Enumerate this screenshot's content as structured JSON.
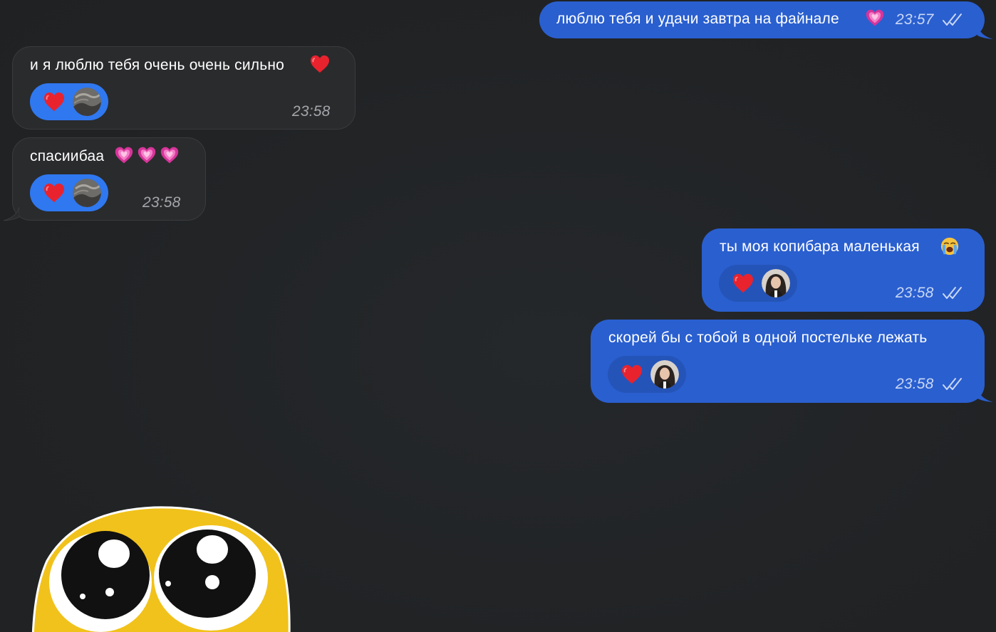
{
  "messages": [
    {
      "id": "m1",
      "direction": "outgoing",
      "text": "люблю тебя и удачи завтра на файнале",
      "emoji": "pink-heart",
      "time": "23:57",
      "status": "read"
    },
    {
      "id": "m2",
      "direction": "incoming",
      "text": "и я люблю тебя очень очень сильно",
      "emoji": "red-heart",
      "time": "23:58",
      "reaction": {
        "emoji": "red-heart",
        "reactor": "contact-avatar"
      }
    },
    {
      "id": "m3",
      "direction": "incoming",
      "text": "спасиибаа",
      "emoji": "pink-heart x3",
      "time": "23:58",
      "reaction": {
        "emoji": "red-heart",
        "reactor": "contact-avatar"
      }
    },
    {
      "id": "m4",
      "direction": "outgoing",
      "text": "ты моя копибара маленькая",
      "emoji": "crying-face",
      "time": "23:58",
      "status": "read",
      "reaction": {
        "emoji": "red-heart",
        "reactor": "own-avatar"
      }
    },
    {
      "id": "m5",
      "direction": "outgoing",
      "text": "скорей бы с тобой в одной постельке лежать",
      "time": "23:58",
      "status": "read",
      "reaction": {
        "emoji": "red-heart",
        "reactor": "own-avatar"
      }
    }
  ],
  "sticker": {
    "name": "pleading-eyes-sticker"
  },
  "colors": {
    "background": "#232527",
    "incoming_bubble": "#2a2b2d",
    "outgoing_bubble": "#2a5fcf",
    "reaction_incoming": "#2f78f0",
    "reaction_outgoing": "#2554b8"
  }
}
